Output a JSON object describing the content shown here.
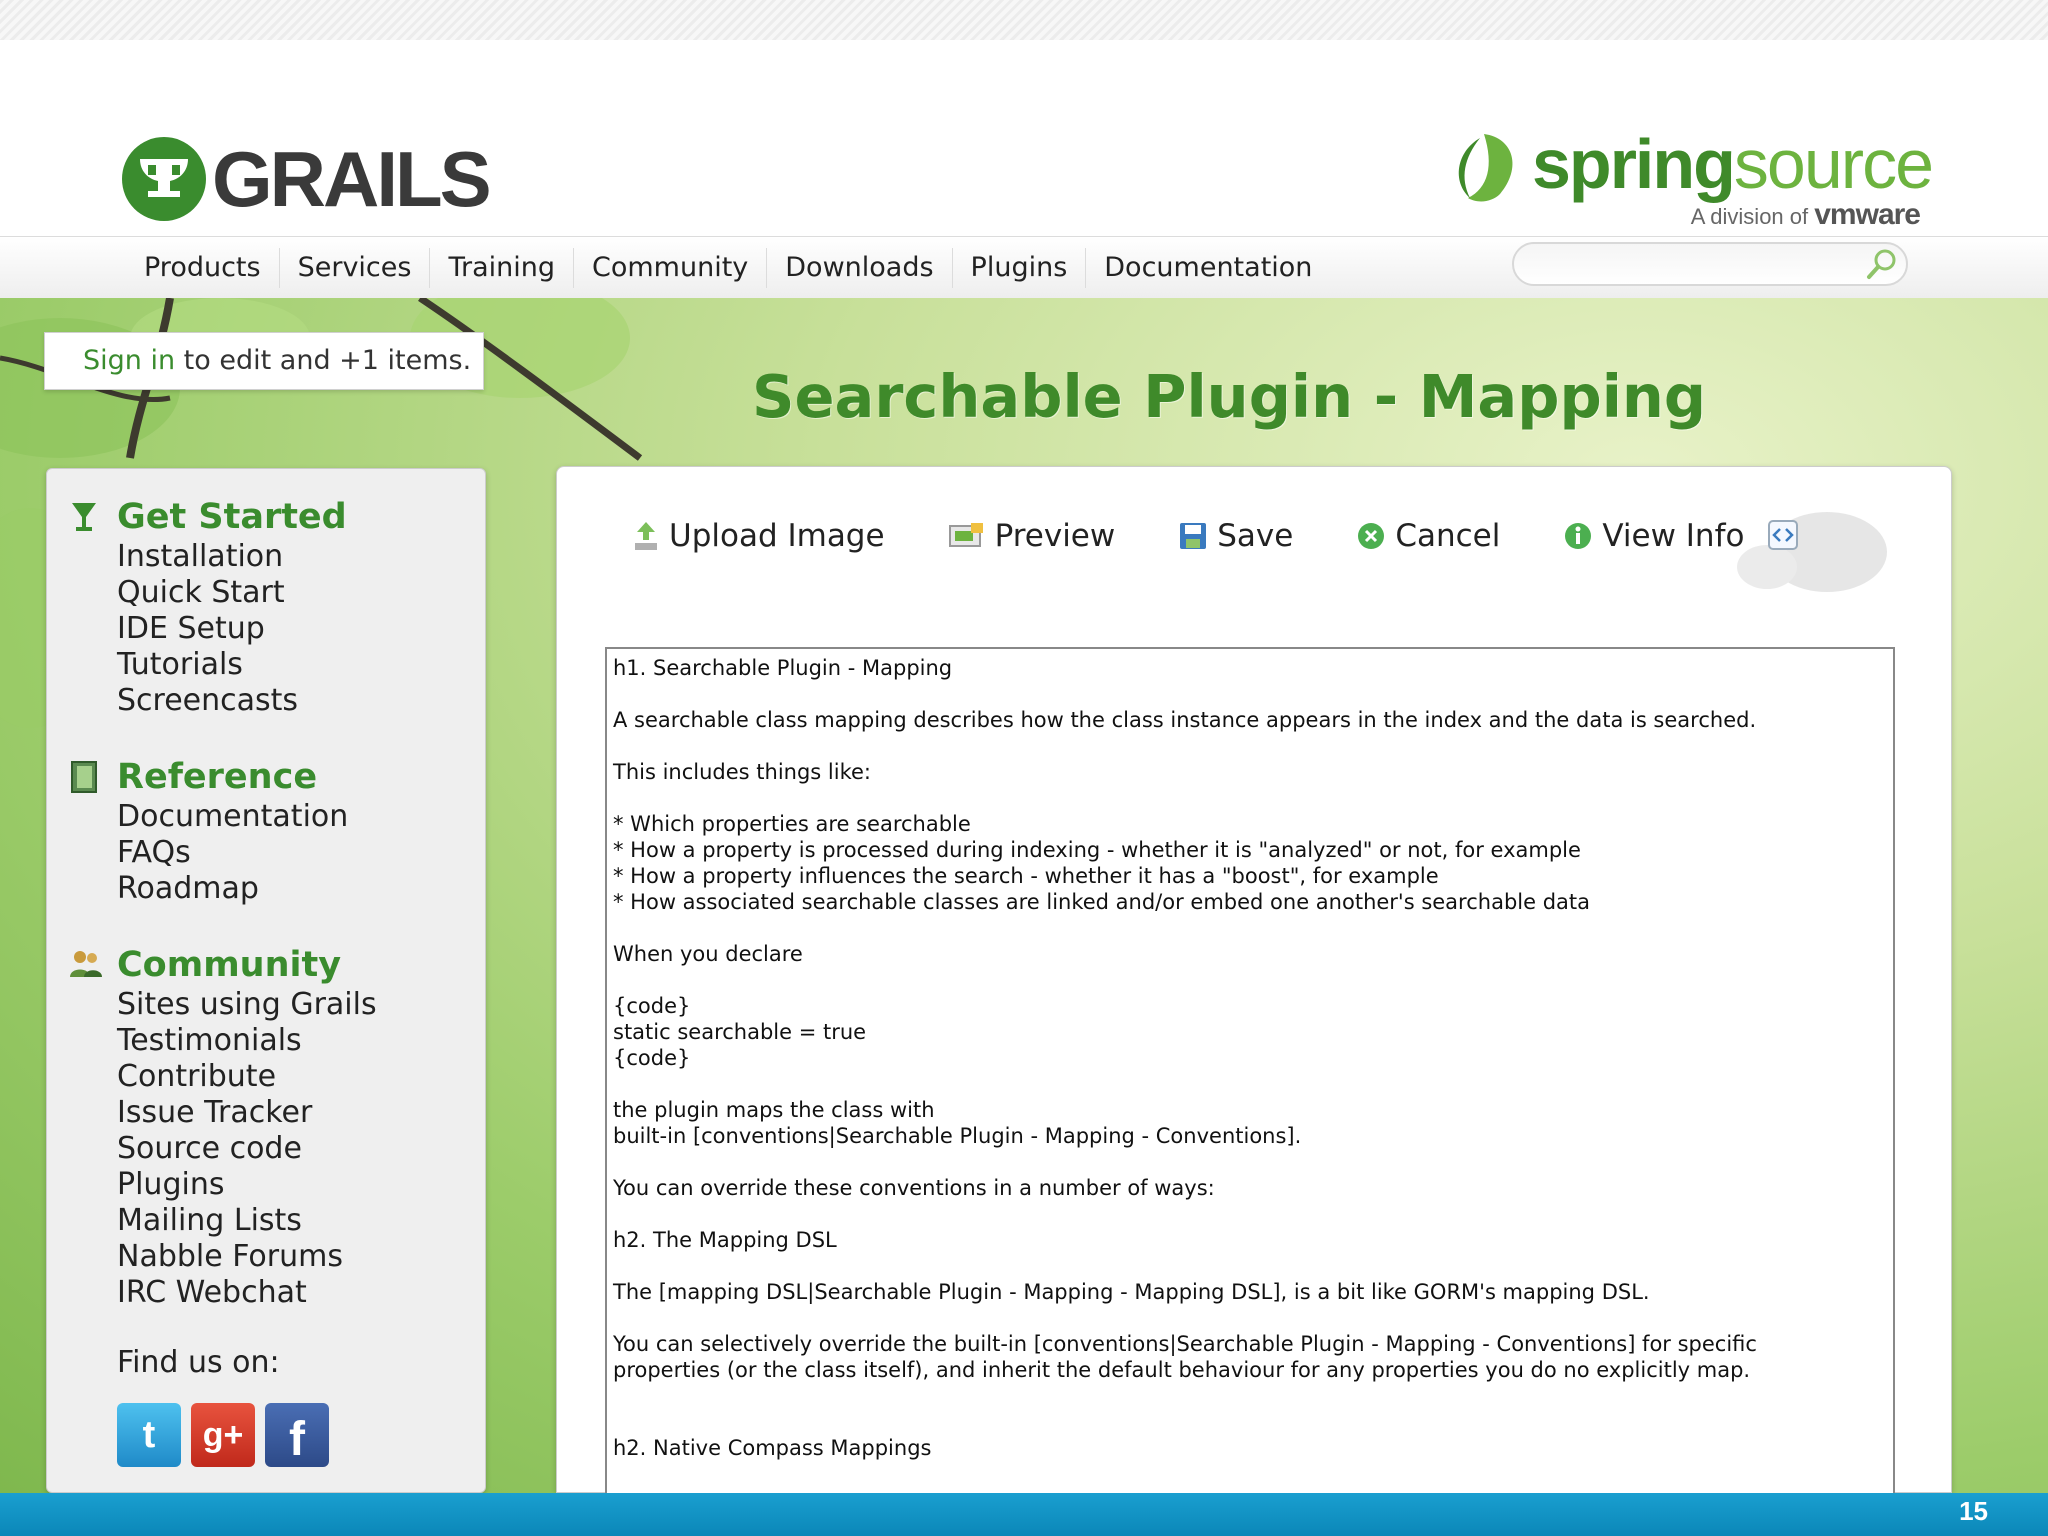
{
  "header": {
    "grails_logo": "GRAILS",
    "spring_word_a": "spring",
    "spring_word_b": "source",
    "spring_division_prefix": "A division of",
    "spring_division_brand": "vmware"
  },
  "nav": {
    "items": [
      "Products",
      "Services",
      "Training",
      "Community",
      "Downloads",
      "Plugins",
      "Documentation"
    ],
    "search_placeholder": ""
  },
  "signin": {
    "link": "Sign in",
    "rest": " to edit and +1 items."
  },
  "page_title": "Searchable Plugin - Mapping",
  "sidebar": {
    "sections": [
      {
        "title": "Get Started",
        "icon": "grail-icon",
        "items": [
          "Installation",
          "Quick Start",
          "IDE Setup",
          "Tutorials",
          "Screencasts"
        ]
      },
      {
        "title": "Reference",
        "icon": "book-icon",
        "items": [
          "Documentation",
          "FAQs",
          "Roadmap"
        ]
      },
      {
        "title": "Community",
        "icon": "people-icon",
        "items": [
          "Sites using Grails",
          "Testimonials",
          "Contribute",
          "Issue Tracker",
          "Source code",
          "Plugins",
          "Mailing Lists",
          "Nabble Forums",
          "IRC Webchat"
        ]
      }
    ],
    "find_us": "Find us on:",
    "social": {
      "twitter": "t",
      "gplus": "g+",
      "facebook": "f"
    }
  },
  "toolbar": {
    "upload": "Upload Image",
    "preview": "Preview",
    "save": "Save",
    "cancel": "Cancel",
    "view_info": "View Info"
  },
  "editor": {
    "lines": [
      "h1. Searchable Plugin - Mapping",
      "",
      "A searchable class mapping describes how the class instance appears in the index and the data is searched.",
      "",
      "This includes things like:",
      "",
      "* Which properties are searchable",
      "* How a property is processed during indexing - whether it is \"analyzed\" or not, for example",
      "* How a property influences the search - whether it has a \"boost\", for example",
      "* How associated searchable classes are linked and/or embed one another's searchable data",
      "",
      "When you declare",
      "",
      "{code}",
      "static searchable = true",
      "{code}",
      "",
      "the plugin maps the class with",
      "built-in [conventions|Searchable Plugin - Mapping - Conventions].",
      "",
      "You can override these conventions in a number of ways:",
      "",
      "h2. The Mapping DSL",
      "",
      "The [mapping DSL|Searchable Plugin - Mapping - Mapping DSL], is a bit like GORM's mapping DSL.",
      "",
      "You can selectively override the built-in [conventions|Searchable Plugin - Mapping - Conventions] for specific",
      "properties (or the class itself), and inherit the default behaviour for any properties you do no explicitly map.",
      "",
      "",
      "h2. Native Compass Mappings"
    ]
  },
  "footer": {
    "page_number": "15"
  },
  "colors": {
    "accent_green": "#3a8c2e",
    "footer_blue": "#0b87b8"
  }
}
